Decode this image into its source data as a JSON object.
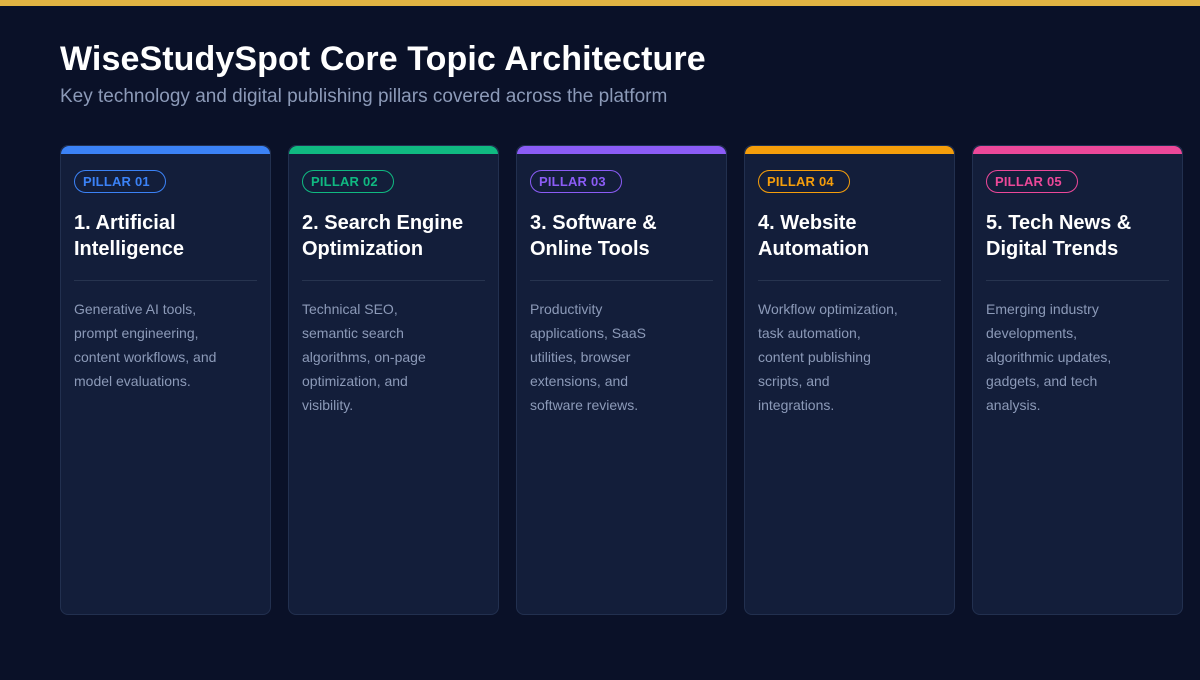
{
  "header": {
    "title": "WiseStudySpot Core Topic Architecture",
    "subtitle": "Key technology and digital publishing pillars covered across the platform"
  },
  "colors": {
    "top_bar": "#e1b443",
    "background": "#0a1128",
    "card_background": "#131e3a"
  },
  "pillars": [
    {
      "badge": "PILLAR 01",
      "title": "1. Artificial Intelligence",
      "description": "Generative AI tools, prompt engineering, content workflows, and model evaluations.",
      "color": "#3b82f6"
    },
    {
      "badge": "PILLAR 02",
      "title": "2. Search Engine Optimization",
      "description": "Technical SEO, semantic search algorithms, on-page optimization, and visibility.",
      "color": "#10b981"
    },
    {
      "badge": "PILLAR 03",
      "title": "3. Software & Online Tools",
      "description": "Productivity applications, SaaS utilities, browser extensions, and software reviews.",
      "color": "#8b5cf6"
    },
    {
      "badge": "PILLAR 04",
      "title": "4. Website Automation",
      "description": "Workflow optimization, task automation, content publishing scripts, and integrations.",
      "color": "#f59e0b"
    },
    {
      "badge": "PILLAR 05",
      "title": "5. Tech News & Digital Trends",
      "description": "Emerging industry developments, algorithmic updates, gadgets, and tech analysis.",
      "color": "#ec4899"
    }
  ]
}
